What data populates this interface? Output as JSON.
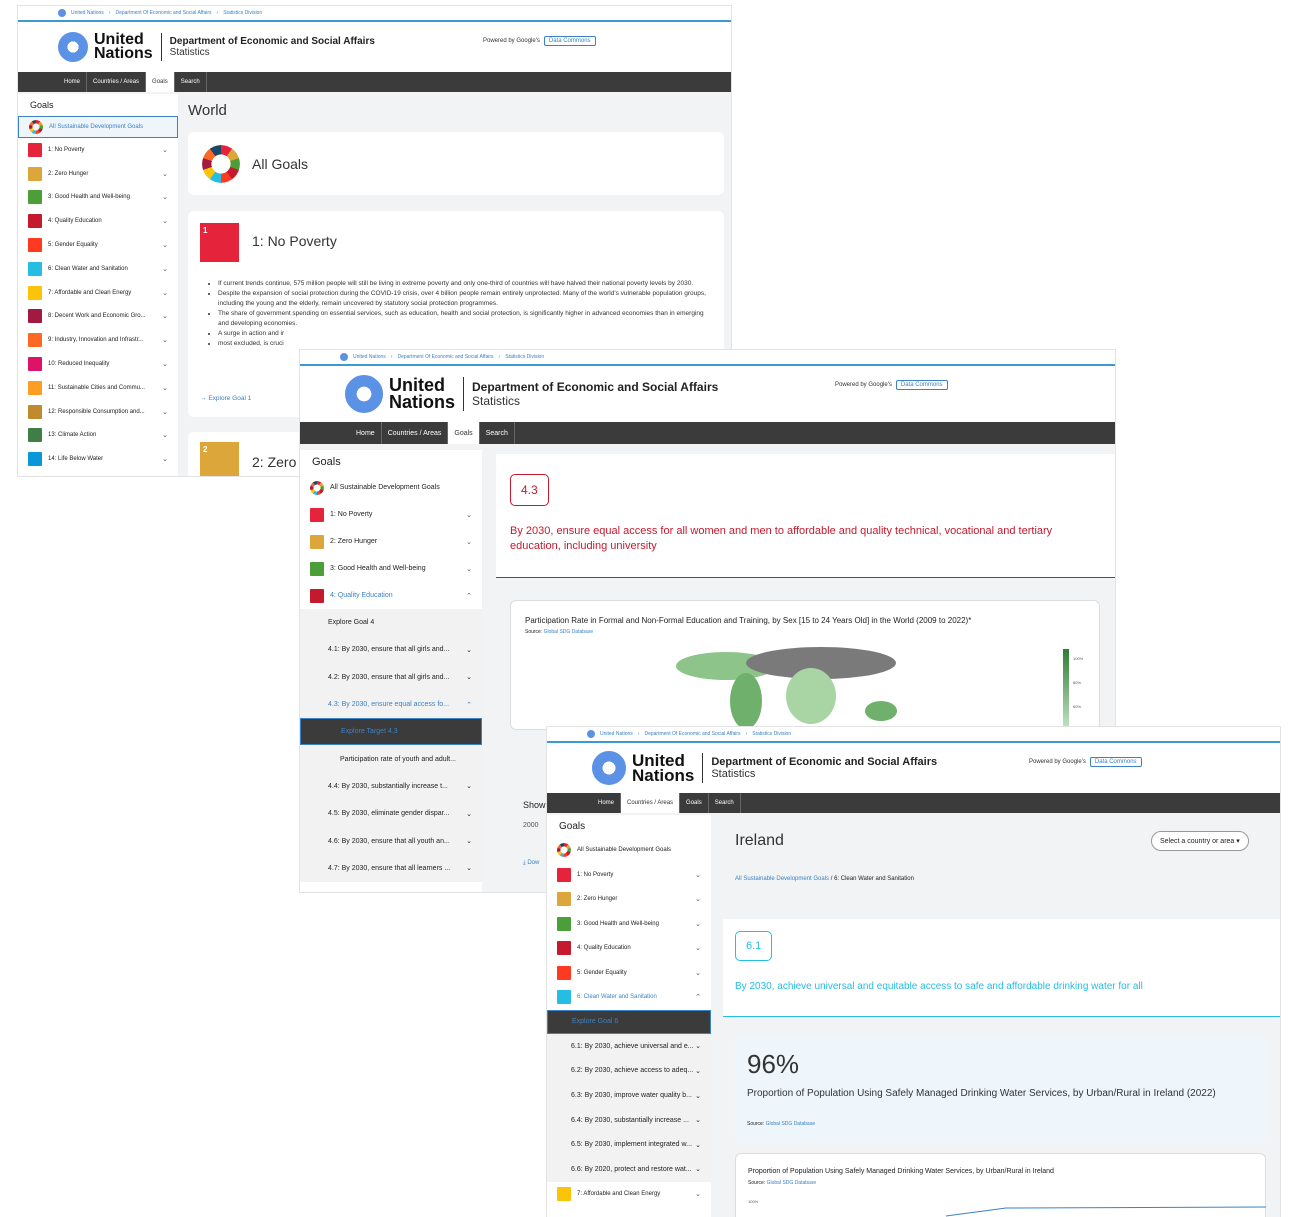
{
  "common": {
    "crumbs": [
      "United Nations",
      "Department Of Economic and Social Affairs",
      "Statistics Division"
    ],
    "sep": "›",
    "un_line1": "United",
    "un_line2": "Nations",
    "dept": "Department of Economic and Social Affairs",
    "division": "Statistics",
    "powered": "Powered by Google's",
    "data_commons": "Data Commons",
    "nav": [
      "Home",
      "Countries / Areas",
      "Goals",
      "Search"
    ],
    "goals_heading": "Goals"
  },
  "goal_colors": [
    "#e5243b",
    "#dda63a",
    "#4c9f38",
    "#c5192d",
    "#ff3a21",
    "#26bde2",
    "#fcc30b",
    "#a21942",
    "#fd6925",
    "#dd1367",
    "#fd9d24",
    "#bf8b2e",
    "#3f7e44",
    "#0a97d9"
  ],
  "w1": {
    "sidebar": [
      "All Sustainable Development Goals",
      "1: No Poverty",
      "2: Zero Hunger",
      "3: Good Health and Well-being",
      "4: Quality Education",
      "5: Gender Equality",
      "6: Clean Water and Sanitation",
      "7: Affordable and Clean Energy",
      "8: Decent Work and Economic Gro...",
      "9: Industry, Innovation and Infrastr...",
      "10: Reduced Inequality",
      "11: Sustainable Cities and Commu...",
      "12: Responsible Consumption and...",
      "13: Climate Action",
      "14: Life Below Water"
    ],
    "page_title": "World",
    "all_goals": "All Goals",
    "goal1_title": "1: No Poverty",
    "goal1_bullets": [
      "If current trends continue, 575 million people will still be living in extreme poverty and only one-third of countries will have halved their national poverty levels by 2030.",
      "Despite the expansion of social protection during the COVID-19 crisis, over 4 billion people remain entirely unprotected. Many of the world's vulnerable population groups, including the young and the elderly, remain uncovered by statutory social protection programmes.",
      "The share of government spending on essential services, such as education, health and social protection, is significantly higher in advanced economies than in emerging and developing economies.",
      "A surge in action and ir",
      "most excluded, is cruci"
    ],
    "explore": "Explore Goal 1",
    "goal2_title": "2: Zero"
  },
  "w2": {
    "sidebar": [
      "All Sustainable Development Goals",
      "1: No Poverty",
      "2: Zero Hunger",
      "3: Good Health and Well-being",
      "4: Quality Education"
    ],
    "sub": [
      "Explore Goal 4",
      "4.1: By 2030, ensure that all girls and...",
      "4.2: By 2030, ensure that all girls and...",
      "4.3: By 2030, ensure equal access fo...",
      "Explore Target 4.3",
      "Participation rate of youth and adult...",
      "4.4: By 2030, substantially increase t...",
      "4.5: By 2030, eliminate gender dispar...",
      "4.6: By 2030, ensure that all youth an...",
      "4.7: By 2030, ensure that all learners ..."
    ],
    "target": "4.3",
    "target_text": "By 2030, ensure equal access for all women and men to affordable and quality technical, vocational and tertiary education, including university",
    "chart_title": "Participation Rate in Formal and Non-Formal Education and Training, by Sex [15 to 24 Years Old] in the World (2009 to 2022)*",
    "source_label": "Source:",
    "source": "Global SDG Database",
    "legend": [
      "100%",
      "80%",
      "60%",
      "40%"
    ],
    "show": "Show",
    "year": "2000",
    "download": "Dow"
  },
  "w3": {
    "sidebar": [
      "All Sustainable Development Goals",
      "1: No Poverty",
      "2: Zero Hunger",
      "3: Good Health and Well-being",
      "4: Quality Education",
      "5: Gender Equality",
      "6: Clean Water and Sanitation"
    ],
    "sub": [
      "Explore Goal 6",
      "6.1: By 2030, achieve universal and e...",
      "6.2: By 2030, achieve access to adeq...",
      "6.3: By 2030, improve water quality b...",
      "6.4: By 2030, substantially increase ...",
      "6.5: By 2030, implement integrated w...",
      "6.6: By 2020, protect and restore wat..."
    ],
    "last_goal": "7: Affordable and Clean Energy",
    "country": "Ireland",
    "select": "Select a country or area",
    "bc1": "All Sustainable Development Goals",
    "bc_sep": "/",
    "bc2": "6: Clean Water and Sanitation",
    "target": "6.1",
    "target_text": "By 2030, achieve universal and equitable access to safe and affordable drinking water for all",
    "stat": "96%",
    "stat_label": "Proportion of Population Using Safely Managed Drinking Water Services, by Urban/Rural in Ireland (2022)",
    "source_label": "Source:",
    "source": "Global SDG Database",
    "chart_title": "Proportion of Population Using Safely Managed Drinking Water Services, by Urban/Rural in Ireland",
    "ytick": "100%"
  }
}
